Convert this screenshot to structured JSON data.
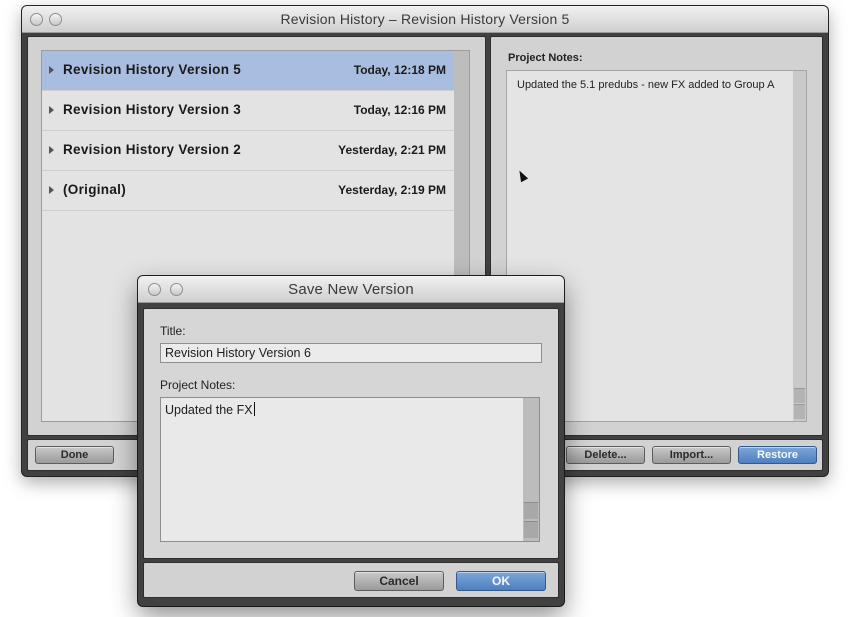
{
  "main_window": {
    "title": "Revision History – Revision History Version 5",
    "versions": [
      {
        "name": "Revision History Version 5",
        "date": "Today, 12:18 PM",
        "selected": true
      },
      {
        "name": "Revision History Version 3",
        "date": "Today, 12:16 PM",
        "selected": false
      },
      {
        "name": "Revision History Version 2",
        "date": "Yesterday, 2:21 PM",
        "selected": false
      },
      {
        "name": "(Original)",
        "date": "Yesterday, 2:19 PM",
        "selected": false
      }
    ],
    "notes_heading": "Project Notes:",
    "notes_text": "Updated the 5.1 predubs - new FX added to Group A",
    "buttons": {
      "done": "Done",
      "delete": "Delete...",
      "import": "Import...",
      "restore": "Restore"
    }
  },
  "save_dialog": {
    "title": "Save New Version",
    "title_label": "Title:",
    "title_value": "Revision History Version 6",
    "notes_label": "Project Notes:",
    "notes_value": "Updated the FX",
    "buttons": {
      "cancel": "Cancel",
      "ok": "OK"
    }
  },
  "colors": {
    "selection": "#a9bde0",
    "primary_button": "#5b8ccb",
    "window_frame": "#414141"
  }
}
